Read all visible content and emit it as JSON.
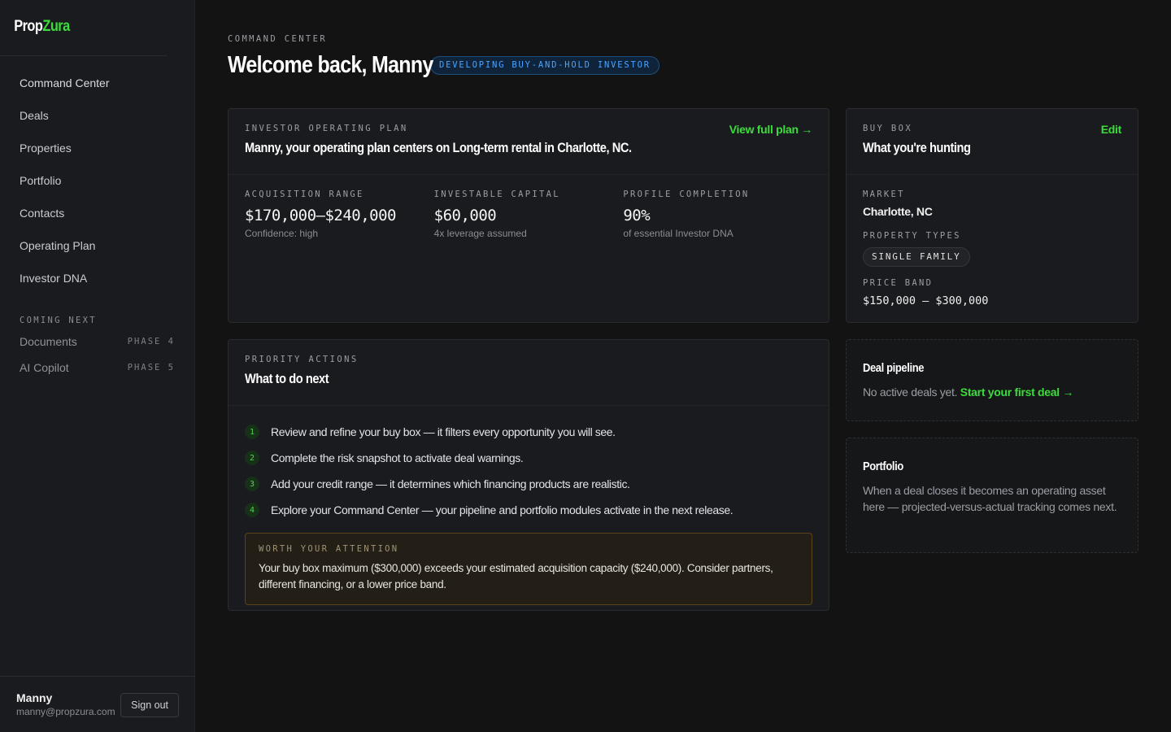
{
  "app": {
    "logo_part1": "Prop",
    "logo_part2": "Zura"
  },
  "sidebar": {
    "items": [
      {
        "label": "Command Center"
      },
      {
        "label": "Deals"
      },
      {
        "label": "Properties"
      },
      {
        "label": "Portfolio"
      },
      {
        "label": "Contacts"
      },
      {
        "label": "Operating Plan"
      },
      {
        "label": "Investor DNA"
      }
    ],
    "coming_next_label": "COMING NEXT",
    "coming_next": [
      {
        "label": "Documents",
        "phase": "PHASE 4"
      },
      {
        "label": "AI Copilot",
        "phase": "PHASE 5"
      }
    ],
    "user": {
      "name": "Manny",
      "email": "manny@propzura.com",
      "signout": "Sign out"
    }
  },
  "header": {
    "eyebrow": "COMMAND CENTER",
    "title": "Welcome back, Manny",
    "badge": "DEVELOPING BUY-AND-HOLD INVESTOR"
  },
  "plan": {
    "eyebrow": "INVESTOR OPERATING PLAN",
    "title": "Manny, your operating plan centers on Long-term rental in Charlotte, NC.",
    "link": "View full plan →",
    "stats": [
      {
        "label": "ACQUISITION RANGE",
        "value": "$170,000–$240,000",
        "sub": "Confidence: high"
      },
      {
        "label": "INVESTABLE CAPITAL",
        "value": "$60,000",
        "sub": "4x leverage assumed"
      },
      {
        "label": "PROFILE COMPLETION",
        "value": "90%",
        "sub": "of essential Investor DNA"
      }
    ]
  },
  "buybox": {
    "eyebrow": "BUY BOX",
    "title": "What you're hunting",
    "edit": "Edit",
    "market_label": "MARKET",
    "market": "Charlotte, NC",
    "types_label": "PROPERTY TYPES",
    "type_chip": "SINGLE FAMILY",
    "band_label": "PRICE BAND",
    "band": "$150,000 – $300,000"
  },
  "priority": {
    "eyebrow": "PRIORITY ACTIONS",
    "title": "What to do next",
    "actions": [
      {
        "num": "1",
        "text": "Review and refine your buy box — it filters every opportunity you will see."
      },
      {
        "num": "2",
        "text": "Complete the risk snapshot to activate deal warnings."
      },
      {
        "num": "3",
        "text": "Add your credit range — it determines which financing products are realistic."
      },
      {
        "num": "4",
        "text": "Explore your Command Center — your pipeline and portfolio modules activate in the next release."
      }
    ],
    "attention_label": "WORTH YOUR ATTENTION",
    "attention_text": "Your buy box maximum ($300,000) exceeds your estimated acquisition capacity ($240,000). Consider partners, different financing, or a lower price band."
  },
  "pipeline": {
    "title": "Deal pipeline",
    "text": "No active deals yet.",
    "link": "Start your first deal →"
  },
  "portfolio": {
    "title": "Portfolio",
    "text": "When a deal closes it becomes an operating asset here — projected-versus-actual tracking comes next."
  }
}
